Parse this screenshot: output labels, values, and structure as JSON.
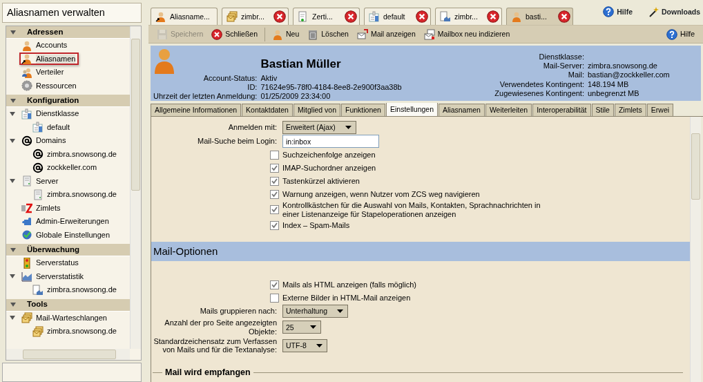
{
  "sidebar": {
    "title": "Aliasnamen verwalten",
    "sections": [
      {
        "label": "Adressen",
        "expanded": true,
        "items": [
          {
            "label": "Accounts",
            "kind": "person",
            "selected": false
          },
          {
            "label": "Aliasnamen",
            "kind": "alias",
            "selected": true
          },
          {
            "label": "Verteiler",
            "kind": "group",
            "selected": false
          },
          {
            "label": "Ressourcen",
            "kind": "gear",
            "selected": false
          }
        ]
      },
      {
        "label": "Konfiguration",
        "expanded": true,
        "items": [
          {
            "label": "Dienstklasse",
            "kind": "cos",
            "selected": false,
            "expanded": true,
            "children": [
              {
                "label": "default",
                "kind": "cos",
                "selected": false
              }
            ]
          },
          {
            "label": "Domains",
            "kind": "at",
            "selected": false,
            "expanded": true,
            "children": [
              {
                "label": "zimbra.snowsong.de",
                "kind": "at",
                "selected": false
              },
              {
                "label": "zockkeller.com",
                "kind": "at",
                "selected": false
              }
            ]
          },
          {
            "label": "Server",
            "kind": "server",
            "selected": false,
            "expanded": true,
            "children": [
              {
                "label": "zimbra.snowsong.de",
                "kind": "server",
                "selected": false
              }
            ]
          },
          {
            "label": "Zimlets",
            "kind": "zimlet",
            "selected": false
          },
          {
            "label": "Admin-Erweiterungen",
            "kind": "plugin",
            "selected": false
          },
          {
            "label": "Globale Einstellungen",
            "kind": "globe",
            "selected": false
          }
        ]
      },
      {
        "label": "Überwachung",
        "expanded": true,
        "items": [
          {
            "label": "Serverstatus",
            "kind": "traffic",
            "selected": false
          },
          {
            "label": "Serverstatistik",
            "kind": "chart",
            "selected": false,
            "expanded": true,
            "children": [
              {
                "label": "zimbra.snowsong.de",
                "kind": "docchart",
                "selected": false
              }
            ]
          }
        ]
      },
      {
        "label": "Tools",
        "expanded": true,
        "items": [
          {
            "label": "Mail-Warteschlangen",
            "kind": "envelopes",
            "selected": false,
            "expanded": true,
            "children": [
              {
                "label": "zimbra.snowsong.de",
                "kind": "envelopes",
                "selected": false
              }
            ]
          }
        ]
      }
    ]
  },
  "tabs": [
    {
      "label": "Aliasname...",
      "kind": "alias",
      "closable": false,
      "selected": false
    },
    {
      "label": "zimbr...",
      "kind": "envelopes",
      "closable": true,
      "selected": false
    },
    {
      "label": "Zerti...",
      "kind": "cert",
      "closable": true,
      "selected": false
    },
    {
      "label": "default",
      "kind": "cos",
      "closable": true,
      "selected": false
    },
    {
      "label": "zimbr...",
      "kind": "docchart",
      "closable": true,
      "selected": false
    },
    {
      "label": "basti...",
      "kind": "person",
      "closable": true,
      "selected": true
    }
  ],
  "top_links": [
    {
      "label": "Hilfe",
      "kind": "help"
    },
    {
      "label": "Downloads",
      "kind": "wand"
    }
  ],
  "toolbar": {
    "buttons": [
      {
        "label": "Speichern",
        "kind": "save",
        "disabled": true
      },
      {
        "label": "Schließen",
        "kind": "close",
        "disabled": false
      },
      {
        "kind": "separator"
      },
      {
        "label": "Neu",
        "kind": "person",
        "disabled": false
      },
      {
        "label": "Löschen",
        "kind": "trash",
        "disabled": false
      },
      {
        "label": "Mail anzeigen",
        "kind": "mailview",
        "disabled": false
      },
      {
        "label": "Mailbox neu indizieren",
        "kind": "reindex",
        "disabled": false
      }
    ],
    "help": {
      "label": "Hilfe",
      "kind": "help"
    }
  },
  "account": {
    "name": "Bastian Müller",
    "fields_left": [
      {
        "label": "Account-Status:",
        "value": "Aktiv"
      },
      {
        "label": "ID:",
        "value": "71624e95-78f0-4184-8ee8-2e900f3aa38b"
      },
      {
        "label": "Uhrzeit der letzten Anmeldung:",
        "value": "01/25/2009 23:34:00"
      }
    ],
    "fields_right": [
      {
        "label": "Dienstklasse:"
      },
      {
        "label": "Mail-Server:",
        "value": "zimbra.snowsong.de"
      },
      {
        "label": "Mail:",
        "value": "bastian@zockkeller.com"
      },
      {
        "label": "Verwendetes Kontingent:",
        "value": "148.194 MB"
      },
      {
        "label": "Zugewiesenes Kontingent:",
        "value": "unbegrenzt MB"
      }
    ]
  },
  "subtabs": [
    {
      "label": "Allgemeine Informationen",
      "selected": false
    },
    {
      "label": "Kontaktdaten",
      "selected": false
    },
    {
      "label": "Mitglied von",
      "selected": false
    },
    {
      "label": "Funktionen",
      "selected": false
    },
    {
      "label": "Einstellungen",
      "selected": true
    },
    {
      "label": "Aliasnamen",
      "selected": false
    },
    {
      "label": "Weiterleiten",
      "selected": false
    },
    {
      "label": "Interoperabilität",
      "selected": false
    },
    {
      "label": "Stile",
      "selected": false
    },
    {
      "label": "Zimlets",
      "selected": false
    },
    {
      "label": "Erwei",
      "selected": false
    }
  ],
  "settings": [
    {
      "kind": "select",
      "label": "Anmelden mit:",
      "value": "Erweitert (Ajax)"
    },
    {
      "kind": "input",
      "label": "Mail-Suche beim Login:",
      "value": "in:inbox"
    },
    {
      "kind": "checkbox",
      "label": "Suchzeichenfolge anzeigen",
      "checked": false
    },
    {
      "kind": "checkbox",
      "label": "IMAP-Suchordner anzeigen",
      "checked": true
    },
    {
      "kind": "checkbox",
      "label": "Tastenkürzel aktivieren",
      "checked": true
    },
    {
      "kind": "checkbox",
      "label": "Warnung anzeigen, wenn Nutzer vom ZCS weg navigieren",
      "checked": true
    },
    {
      "kind": "checkbox",
      "label": "Kontrollkästchen für die Auswahl von Mails, Kontakten, Sprachnachrichten in einer Listenanzeige für Stapeloperationen anzeigen",
      "checked": true
    },
    {
      "kind": "checkbox",
      "label": "Index – Spam-Mails",
      "checked": true
    },
    {
      "kind": "section",
      "label": "Mail-Optionen"
    },
    {
      "kind": "checkbox",
      "label": "Mails als HTML anzeigen (falls möglich)",
      "checked": true
    },
    {
      "kind": "checkbox",
      "label": "Externe Bilder in HTML-Mail anzeigen",
      "checked": false
    },
    {
      "kind": "select",
      "label": "Mails gruppieren nach:",
      "value": "Unterhaltung"
    },
    {
      "kind": "select",
      "label": "Anzahl der pro Seite angezeigten Objekte:",
      "value": "25"
    },
    {
      "kind": "select",
      "label": "Standardzeichensatz zum Verfassen von Mails und für die Textanalyse:",
      "value": "UTF-8"
    },
    {
      "kind": "legend",
      "label": "Mail wird empfangen"
    }
  ]
}
